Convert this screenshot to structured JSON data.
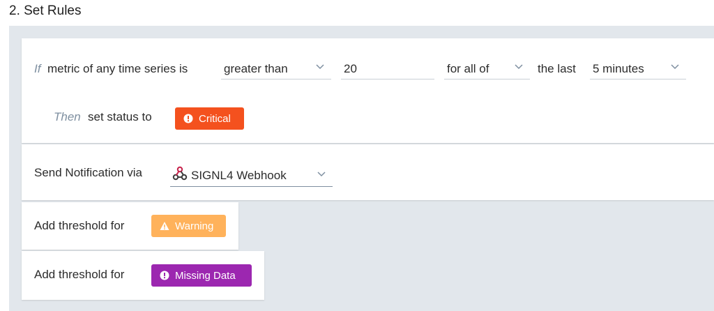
{
  "section": {
    "title": "2. Set Rules"
  },
  "rule": {
    "if_label": "If",
    "condition_text": "metric of any time series is",
    "operator": {
      "value": "greater than"
    },
    "threshold": {
      "value": "20"
    },
    "aggregation": {
      "value": "for all of"
    },
    "the_last_text": "the last",
    "window": {
      "value": "5 minutes"
    },
    "then_label": "Then",
    "set_status_text": "set status to",
    "status_badge": {
      "label": "Critical",
      "color": "#f4511e"
    }
  },
  "notification": {
    "label": "Send Notification via",
    "channel": {
      "value": "SIGNL4 Webhook",
      "icon": "webhook-icon"
    }
  },
  "thresholds": [
    {
      "label": "Add threshold for",
      "badge": "Warning",
      "color": "#ffb25b",
      "icon": "warning-triangle-icon"
    },
    {
      "label": "Add threshold for",
      "badge": "Missing Data",
      "color": "#9c27b0",
      "icon": "exclamation-circle-icon"
    }
  ],
  "colors": {
    "panel_bg": "#e2e7ec",
    "accent_underline": "#7e8fa0"
  }
}
